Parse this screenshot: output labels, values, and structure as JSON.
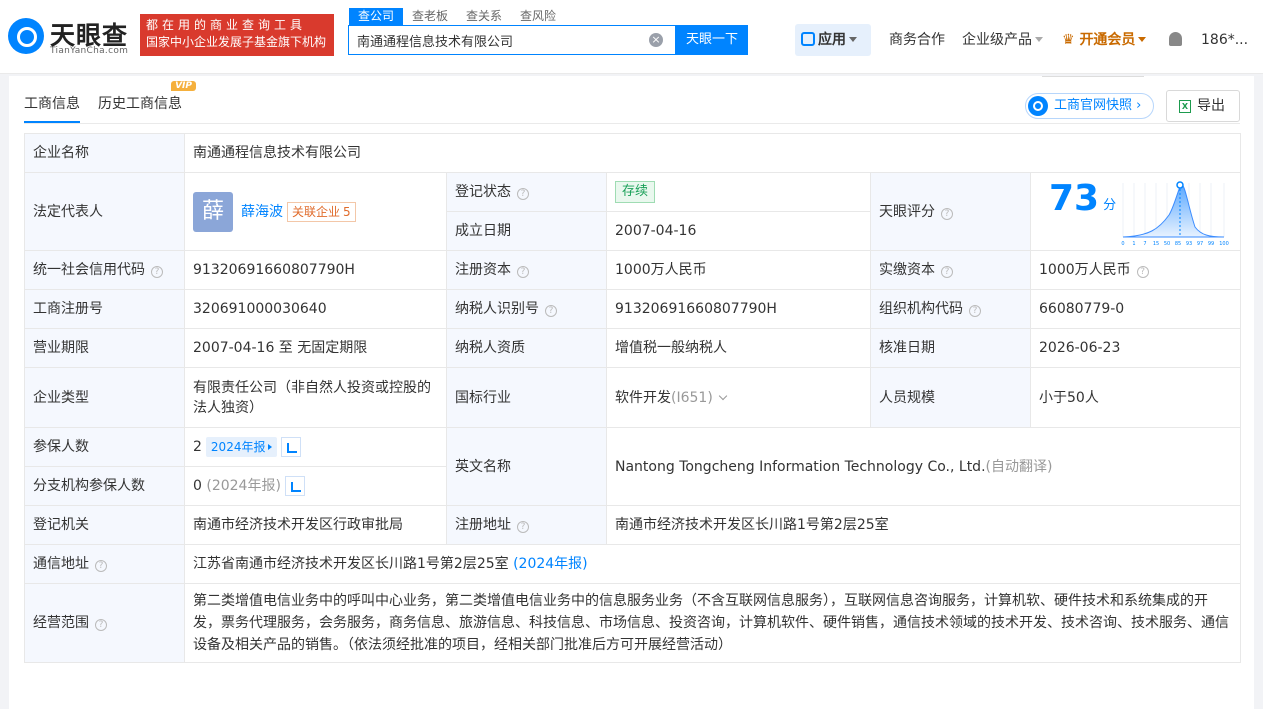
{
  "header": {
    "logo_text": "天眼查",
    "logo_sub": "TianYanCha.com",
    "slogan_line1": "都在用的商业查询工具",
    "slogan_line2": "国家中小企业发展子基金旗下机构",
    "search_tabs": [
      "查公司",
      "查老板",
      "查关系",
      "查风险"
    ],
    "search_value": "南通通程信息技术有限公司",
    "search_button": "天眼一下",
    "nav_app": "应用",
    "nav_business": "商务合作",
    "nav_enterprise": "企业级产品",
    "nav_vip": "开通会员",
    "nav_user": "186*..."
  },
  "toolbar": {
    "tab_basic": "工商信息",
    "tab_history": "历史工商信息",
    "vip_badge": "VIP",
    "snapshot_button": "工商官网快照",
    "export_button": "导出"
  },
  "info": {
    "company_name_label": "企业名称",
    "company_name": "南通通程信息技术有限公司",
    "legal_rep_label": "法定代表人",
    "legal_rep_avatar": "薛",
    "legal_rep_name": "薛海波",
    "related_label": "关联企业",
    "related_count": "5",
    "reg_status_label": "登记状态",
    "reg_status": "存续",
    "found_date_label": "成立日期",
    "found_date": "2007-04-16",
    "score_label": "天眼评分",
    "score_value": "73",
    "score_unit": "分",
    "credit_code_label": "统一社会信用代码",
    "credit_code": "91320691660807790H",
    "reg_capital_label": "注册资本",
    "reg_capital": "1000万人民币",
    "paid_capital_label": "实缴资本",
    "paid_capital": "1000万人民币",
    "reg_no_label": "工商注册号",
    "reg_no": "320691000030640",
    "taxpayer_id_label": "纳税人识别号",
    "taxpayer_id": "91320691660807790H",
    "org_code_label": "组织机构代码",
    "org_code": "66080779-0",
    "term_label": "营业期限",
    "term": "2007-04-16 至 无固定期限",
    "taxpayer_qual_label": "纳税人资质",
    "taxpayer_qual": "增值税一般纳税人",
    "approve_date_label": "核准日期",
    "approve_date": "2026-06-23",
    "type_label": "企业类型",
    "type": "有限责任公司（非自然人投资或控股的法人独资）",
    "industry_label": "国标行业",
    "industry": "软件开发",
    "industry_code": "(I651)",
    "staff_label": "人员规模",
    "staff": "小于50人",
    "insured_label": "参保人数",
    "insured": "2",
    "insured_year": "2024年报",
    "branch_insured_label": "分支机构参保人数",
    "branch_insured": "0",
    "branch_insured_year": "(2024年报)",
    "english_name_label": "英文名称",
    "english_name": "Nantong Tongcheng Information Technology Co., Ltd.",
    "english_name_note": "(自动翻译)",
    "authority_label": "登记机关",
    "authority": "南通市经济技术开发区行政审批局",
    "reg_address_label": "注册地址",
    "reg_address": "南通市经济技术开发区长川路1号第2层25室",
    "contact_address_label": "通信地址",
    "contact_address": "江苏省南通市经济技术开发区长川路1号第2层25室",
    "contact_address_year": "(2024年报)",
    "scope_label": "经营范围",
    "scope": "第二类增值电信业务中的呼叫中心业务，第二类增值电信业务中的信息服务业务（不含互联网信息服务），互联网信息咨询服务，计算机软、硬件技术和系统集成的开发，票务代理服务，会务服务，商务信息、旅游信息、科技信息、市场信息、投资咨询，计算机软件、硬件销售，通信技术领域的技术开发、技术咨询、技术服务、通信设备及相关产品的销售。（依法须经批准的项目，经相关部门批准后方可开展经营活动）"
  },
  "score_chart": {
    "x_ticks": [
      "0",
      "1",
      "7",
      "15",
      "50",
      "85",
      "93",
      "97",
      "99",
      "100"
    ],
    "marker": "73"
  },
  "colors": {
    "brand": "#0084ff",
    "slogan_bg": "#d93a2d",
    "label_bg": "#f5f8fe"
  }
}
